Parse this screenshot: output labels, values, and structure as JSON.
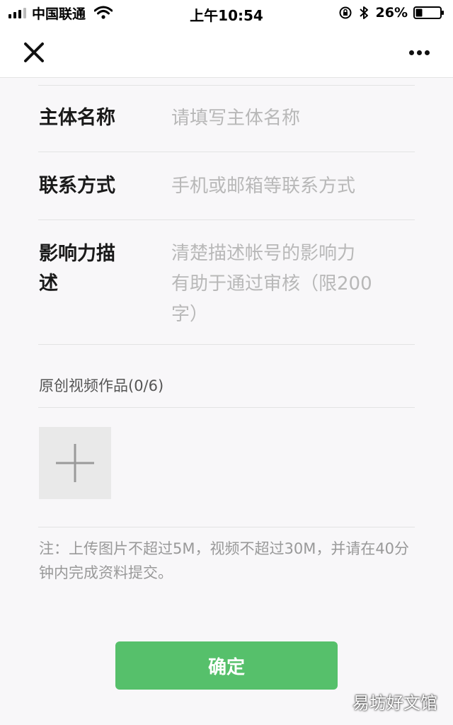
{
  "status_bar": {
    "carrier": "中国联通",
    "time": "上午10:54",
    "battery": "26%"
  },
  "form": {
    "fields": [
      {
        "label": "主体名称",
        "placeholder": "请填写主体名称"
      },
      {
        "label": "联系方式",
        "placeholder": "手机或邮箱等联系方式"
      },
      {
        "label_line1": "影响力描",
        "label_line2": "述",
        "placeholder": "清楚描述帐号的影响力\n有助于通过审核（限200\n字）"
      }
    ],
    "works_section_title": "原创视频作品(0/6)",
    "note": "注：上传图片不超过5M，视频不超过30M，并请在40分钟内完成资料提交。",
    "confirm_label": "确定"
  },
  "watermark": "易坊好文馆",
  "icons": {
    "close": "close-icon",
    "more": "more-icon",
    "add": "plus-icon",
    "wifi": "wifi-icon",
    "bluetooth": "bluetooth-icon",
    "rotation_lock": "rotation-lock-icon",
    "battery": "battery-icon"
  },
  "colors": {
    "primary_button": "#56c06b",
    "placeholder_text": "#b8b8b8",
    "page_background": "#f8f7f9"
  }
}
